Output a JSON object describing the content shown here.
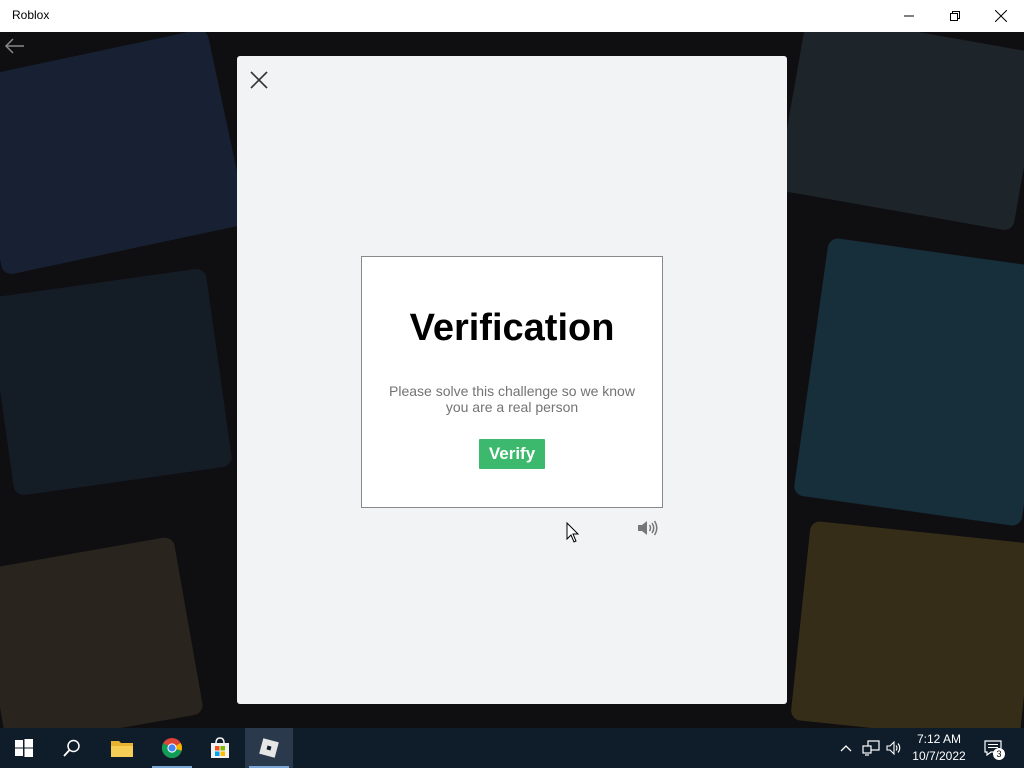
{
  "window": {
    "title": "Roblox"
  },
  "modal": {
    "heading": "Verification",
    "message": "Please solve this challenge so we know you are a real person",
    "verify_label": "Verify"
  },
  "taskbar": {
    "items": [
      "start-icon",
      "search-icon",
      "file-explorer-icon",
      "chrome-icon",
      "microsoft-store-icon",
      "roblox-icon"
    ],
    "active_item": "roblox-icon",
    "time": "7:12 AM",
    "date": "10/7/2022",
    "notification_count": "3"
  },
  "colors": {
    "verify_button": "#3cb96c",
    "modal_bg": "#f2f3f4",
    "taskbar_bg": "#0f1c2a"
  }
}
